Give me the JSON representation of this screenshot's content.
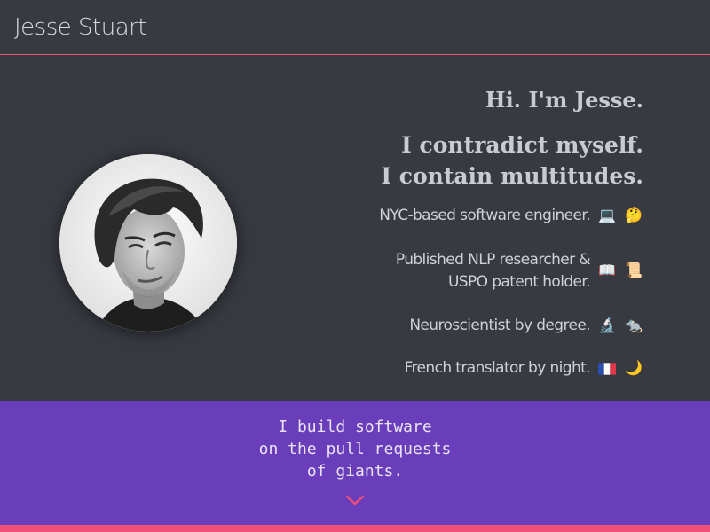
{
  "header": {
    "site_title": "Jesse Stuart",
    "accent_color": "#e8536f"
  },
  "hero": {
    "greeting": "Hi. I'm Jesse.",
    "motto_lines": [
      "I contradict myself.",
      "I contain multitudes."
    ],
    "avatar": "avatar-photo",
    "facts": [
      {
        "lines": [
          "NYC-based software engineer."
        ],
        "icons": [
          "laptop-icon",
          "thinking-face-icon"
        ],
        "emoji": [
          "💻",
          "🤔"
        ]
      },
      {
        "lines": [
          "Published NLP researcher &",
          "USPO patent holder."
        ],
        "icons": [
          "book-icon",
          "scroll-icon"
        ],
        "emoji": [
          "📖",
          "📜"
        ]
      },
      {
        "lines": [
          "Neuroscientist by degree."
        ],
        "icons": [
          "microscope-icon",
          "rat-icon"
        ],
        "emoji": [
          "🔬",
          "🐀"
        ]
      },
      {
        "lines": [
          "French translator by night."
        ],
        "icons": [
          "french-flag-icon",
          "crescent-moon-icon"
        ],
        "emoji": [
          "🇫🇷",
          "🌙"
        ]
      }
    ]
  },
  "banner": {
    "tagline_lines": [
      "I build software",
      "on the pull requests",
      "of giants."
    ],
    "background_color": "#6a3dbb",
    "scroll_icon": "chevron-down-icon"
  },
  "footer": {
    "bar_color": "#ee4f78"
  }
}
